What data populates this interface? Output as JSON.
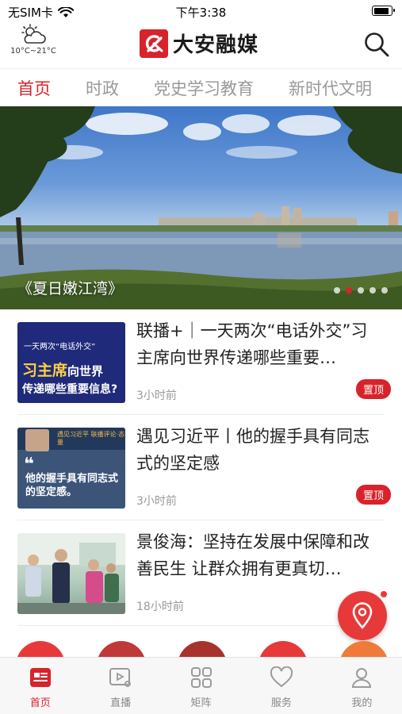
{
  "status_bar": {
    "carrier": "无SIM卡",
    "time": "下午3:38",
    "battery_level": 0.85
  },
  "header": {
    "weather_icon": "partly-cloudy-icon",
    "temperature": "10°C~21°C",
    "app_name": "大安融媒",
    "search_icon": "search-icon"
  },
  "tabs": [
    {
      "label": "首页",
      "active": true
    },
    {
      "label": "时政",
      "active": false
    },
    {
      "label": "党史学习教育",
      "active": false
    },
    {
      "label": "新时代文明",
      "active": false
    }
  ],
  "banner": {
    "caption": "《夏日嫩江湾》",
    "slide_count": 5,
    "active_slide": 2
  },
  "news": [
    {
      "title": "联播+｜一天两次“电话外交”习主席向世界传递哪些重要…",
      "time": "3小时前",
      "pinned": "置顶",
      "thumb_small": "一天两次“电话外交”",
      "thumb_big": "习主席",
      "thumb_big_tail": "向世界",
      "thumb_line2": "传递哪些重要信息?"
    },
    {
      "title": "遇见习近平丨他的握手具有同志式的坚定感",
      "time": "3小时前",
      "pinned": "置顶",
      "thumb_tag": "遇见习近平 联播评论·态量",
      "thumb_quote": "❝",
      "thumb_text": "他的握手具有同志式的坚定感。"
    },
    {
      "title": "景俊海：坚持在发展中保障和改善民生 让群众拥有更真切…",
      "time": "18小时前",
      "pinned": ""
    }
  ],
  "bottom_nav": [
    {
      "label": "首页",
      "icon": "news-icon",
      "active": true
    },
    {
      "label": "直播",
      "icon": "live-tv-icon",
      "active": false
    },
    {
      "label": "矩阵",
      "icon": "grid-icon",
      "active": false
    },
    {
      "label": "服务",
      "icon": "heart-icon",
      "active": false
    },
    {
      "label": "我的",
      "icon": "user-icon",
      "active": false
    }
  ],
  "colors": {
    "accent": "#d8232a",
    "inactive_text": "#999999"
  }
}
